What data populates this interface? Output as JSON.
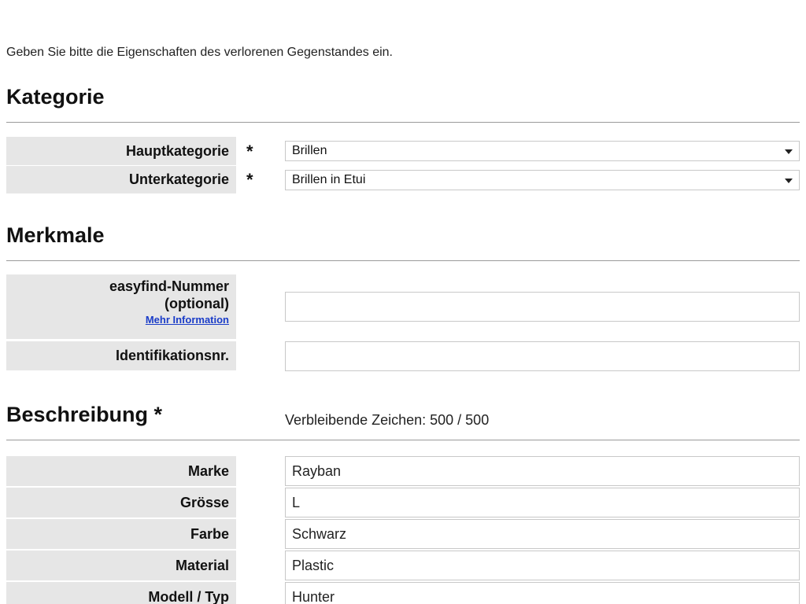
{
  "intro_text": "Geben Sie bitte die Eigenschaften des verlorenen Gegenstandes ein.",
  "sections": {
    "kategorie": {
      "title": "Kategorie",
      "hauptkategorie_label": "Hauptkategorie",
      "hauptkategorie_value": "Brillen",
      "unterkategorie_label": "Unterkategorie",
      "unterkategorie_value": "Brillen in Etui",
      "required_marker": "*"
    },
    "merkmale": {
      "title": "Merkmale",
      "easyfind_label_line1": "easyfind-Nummer",
      "easyfind_label_line2": "(optional)",
      "easyfind_link": "Mehr Information",
      "easyfind_value": "",
      "identifikation_label": "Identifikationsnr.",
      "identifikation_value": ""
    },
    "beschreibung": {
      "title": "Beschreibung *",
      "remaining_chars": "Verbleibende Zeichen: 500 / 500",
      "fields": [
        {
          "label": "Marke",
          "value": "Rayban"
        },
        {
          "label": "Grösse",
          "value": "L"
        },
        {
          "label": "Farbe",
          "value": "Schwarz"
        },
        {
          "label": "Material",
          "value": "Plastic"
        },
        {
          "label": "Modell / Typ",
          "value": "Hunter"
        }
      ]
    }
  },
  "icons": {
    "dropdown": "chevron-down-icon"
  }
}
